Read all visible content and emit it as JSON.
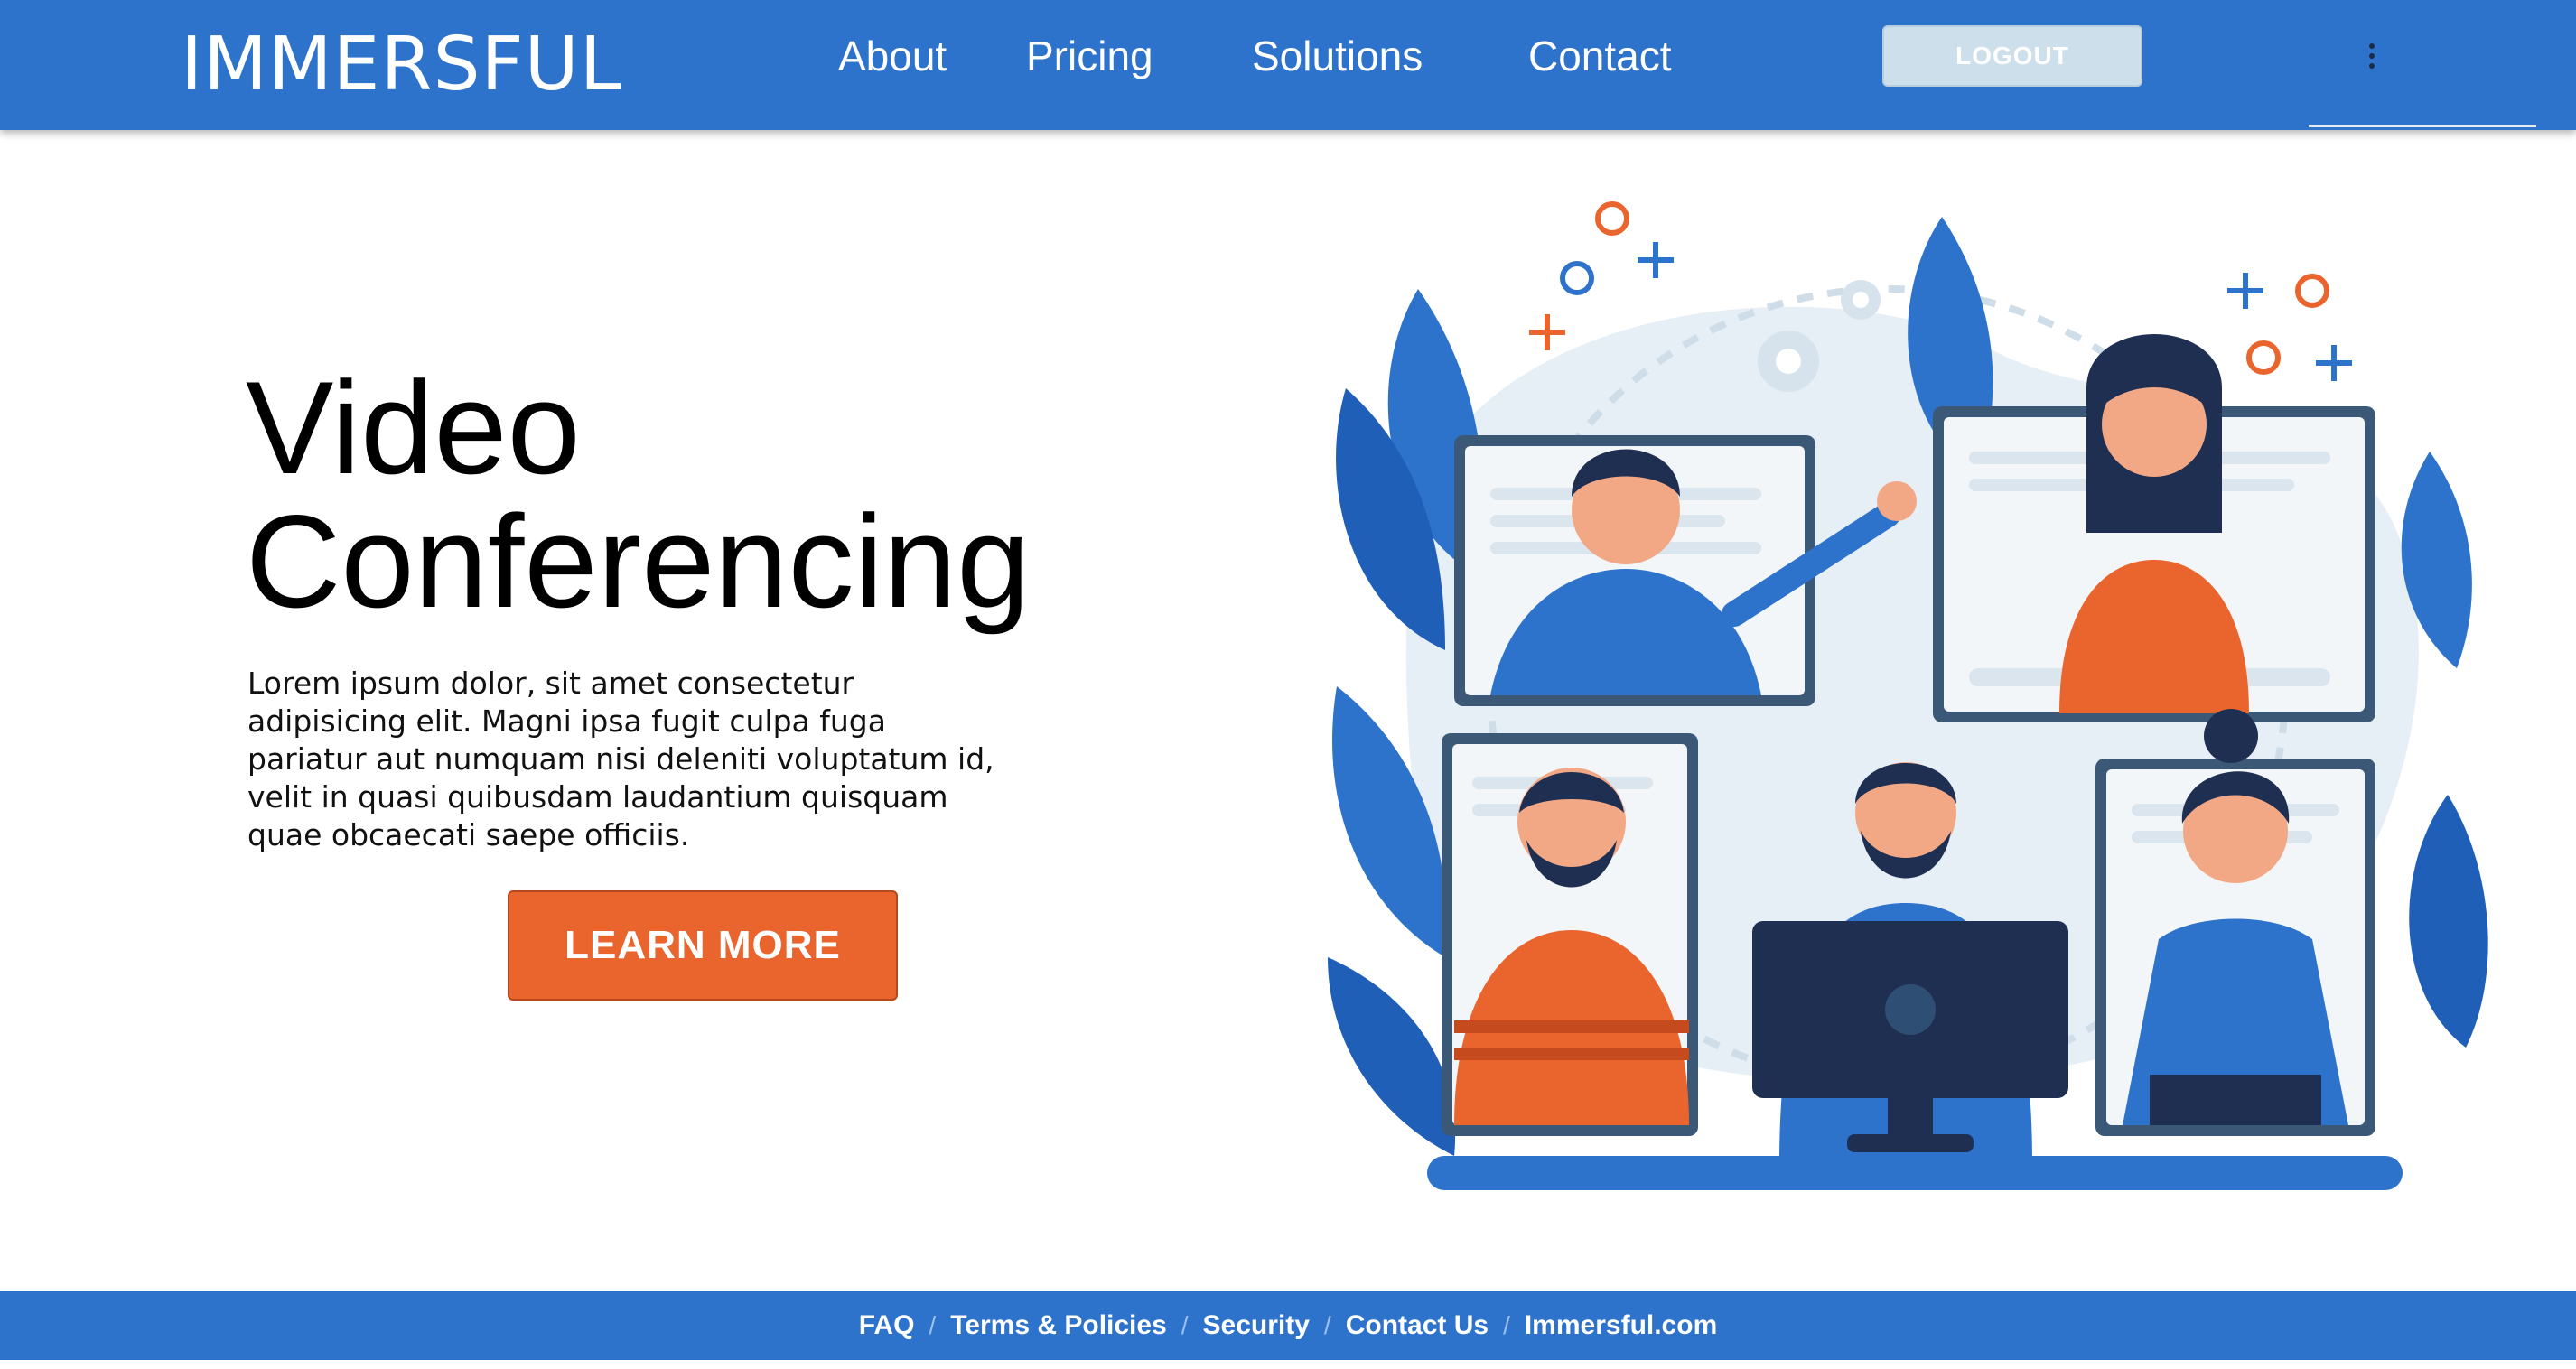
{
  "header": {
    "brand": "IMMERSFUL",
    "nav": {
      "about": "About",
      "pricing": "Pricing",
      "solutions": "Solutions",
      "contact": "Contact"
    },
    "logout_label": "LOGOUT",
    "menu_icon": "kebab-menu-icon"
  },
  "hero": {
    "title_line1": "Video",
    "title_line2": "Conferencing",
    "body": "Lorem ipsum dolor, sit amet consectetur adipisicing elit. Magni ipsa fugit culpa fuga pariatur aut numquam nisi deleniti voluptatum id, velit in quasi quibusdam laudantium quisquam quae obcaecati saepe officiis.",
    "cta_label": "LEARN MORE"
  },
  "footer": {
    "faq": "FAQ",
    "terms": "Terms & Policies",
    "security": "Security",
    "contact_us": "Contact Us",
    "site": "Immersful.com",
    "separator": "/"
  },
  "colors": {
    "brand_blue": "#2d72cb",
    "accent_orange": "#e9652d",
    "logout_bg": "#cddfeb",
    "dark_navy": "#1f2f52"
  }
}
